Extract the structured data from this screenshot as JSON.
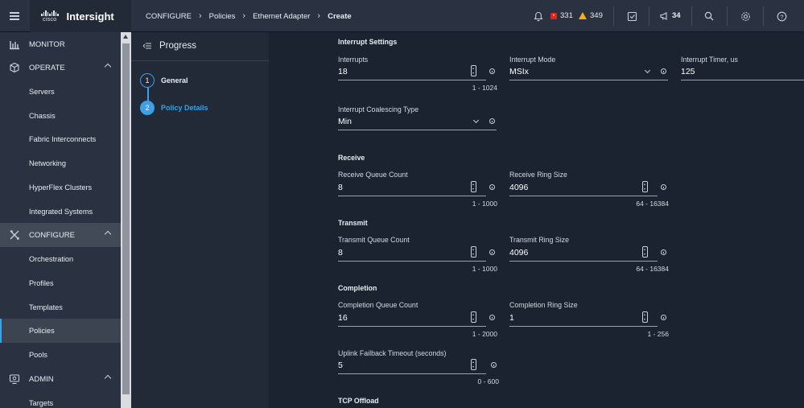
{
  "app": {
    "brand_word": "cisco",
    "name": "Intersight"
  },
  "breadcrumb": {
    "items": [
      "CONFIGURE",
      "Policies",
      "Ethernet Adapter"
    ],
    "current": "Create"
  },
  "topbar": {
    "critical_count": "331",
    "warning_count": "349",
    "announcement_count": "34"
  },
  "sidebar": {
    "monitor": "MONITOR",
    "operate": "OPERATE",
    "operate_items": [
      "Servers",
      "Chassis",
      "Fabric Interconnects",
      "Networking",
      "HyperFlex Clusters",
      "Integrated Systems"
    ],
    "configure": "CONFIGURE",
    "configure_items": [
      "Orchestration",
      "Profiles",
      "Templates",
      "Policies",
      "Pools"
    ],
    "admin": "ADMIN",
    "admin_items": [
      "Targets"
    ],
    "selected": "Policies"
  },
  "progress": {
    "title": "Progress",
    "steps": [
      {
        "num": "1",
        "label": "General"
      },
      {
        "num": "2",
        "label": "Policy Details"
      }
    ]
  },
  "form": {
    "interrupt_settings": "Interrupt Settings",
    "interrupts_label": "Interrupts",
    "interrupts_value": "18",
    "interrupts_range": "1 - 1024",
    "interrupt_mode_label": "Interrupt Mode",
    "interrupt_mode_value": "MSIx",
    "interrupt_timer_label": "Interrupt Timer, us",
    "interrupt_timer_value": "125",
    "coalescing_label": "Interrupt Coalescing Type",
    "coalescing_value": "Min",
    "receive": "Receive",
    "rx_queue_label": "Receive Queue Count",
    "rx_queue_value": "8",
    "rx_queue_range": "1 - 1000",
    "rx_ring_label": "Receive Ring Size",
    "rx_ring_value": "4096",
    "rx_ring_range": "64 - 16384",
    "transmit": "Transmit",
    "tx_queue_label": "Transmit Queue Count",
    "tx_queue_value": "8",
    "tx_queue_range": "1 - 1000",
    "tx_ring_label": "Transmit Ring Size",
    "tx_ring_value": "4096",
    "tx_ring_range": "64 - 16384",
    "completion": "Completion",
    "cq_count_label": "Completion Queue Count",
    "cq_count_value": "16",
    "cq_count_range": "1 - 2000",
    "cq_ring_label": "Completion Ring Size",
    "cq_ring_value": "1",
    "cq_ring_range": "1 - 256",
    "uplink_label": "Uplink Failback Timeout (seconds)",
    "uplink_value": "5",
    "uplink_range": "0 - 600",
    "tcp_offload": "TCP Offload"
  },
  "colors": {
    "accent": "#3ca0e6",
    "critical": "#e2231a",
    "warning": "#fbab18"
  }
}
